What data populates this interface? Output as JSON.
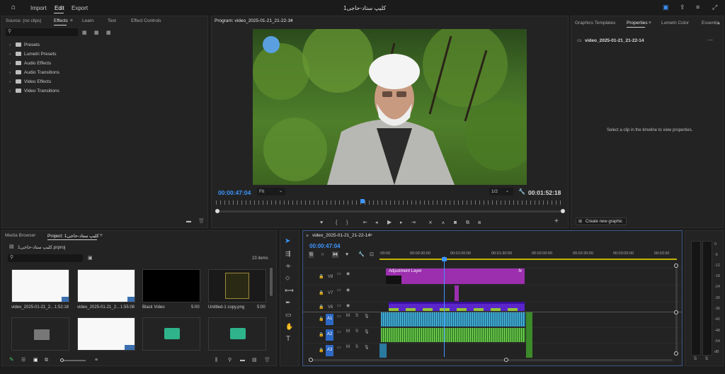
{
  "menubar": {
    "home_icon": "home-icon",
    "import": "Import",
    "edit": "Edit",
    "export": "Export",
    "title": "کلیپ ستاد-حاجی1"
  },
  "effects_panel": {
    "tabs": [
      "Source: (no clips)",
      "Effects",
      "Learn",
      "Text",
      "Effect Controls"
    ],
    "items": [
      "Presets",
      "Lumetri Presets",
      "Audio Effects",
      "Audio Transitions",
      "Video Effects",
      "Video Transitions"
    ]
  },
  "program_monitor": {
    "title": "Program: video_2025-01-21_21-22-14",
    "timecode": "00:00:47:04",
    "fit": "Fit",
    "resolution": "1/2",
    "duration": "00:01:52:18",
    "playhead_fraction": 0.42
  },
  "right_panel": {
    "tabs": [
      "Graphics Templates",
      "Properties",
      "Lumetri Color",
      "Essentia"
    ],
    "clip_name": "video_2025-01-21_21-22-14",
    "message": "Select a clip in the timeline to view properties.",
    "new_graphic": "Create new graphic"
  },
  "project_panel": {
    "tabs": [
      "Media Browser",
      "Project: کلیپ ستاد-حاجی1"
    ],
    "file": "کلیپ ستاد-حاجی1.prproj",
    "count": "23 items",
    "items": [
      {
        "name": "video_2025-01-21_2...",
        "dur": "1:52:18"
      },
      {
        "name": "video_2025-01-21_2...",
        "dur": "1:55:08"
      },
      {
        "name": "Black Video",
        "dur": "5:00"
      },
      {
        "name": "Untitled-1 copy.png",
        "dur": "5:00"
      }
    ]
  },
  "timeline": {
    "sequence": "video_2025-01-21_21-22-14",
    "timecode": "00:00:47:04",
    "ruler": [
      ":00:00",
      "00:00:30:00",
      "00:01:00:00",
      "00:01:30:00",
      "00:02:00:00",
      "00:02:30:00",
      "00:03:00:00",
      "00:03:30"
    ],
    "tracks": [
      "V8",
      "V7",
      "V6",
      "A1",
      "A2",
      "A3"
    ],
    "adjustment_layer": "Adjustment Layer",
    "fx": "fx"
  },
  "meter": {
    "scale": [
      "0",
      "-6",
      "-12",
      "-18",
      "-24",
      "-30",
      "-36",
      "-42",
      "-48",
      "-54",
      "dB"
    ],
    "solo": [
      "S",
      "S"
    ]
  }
}
